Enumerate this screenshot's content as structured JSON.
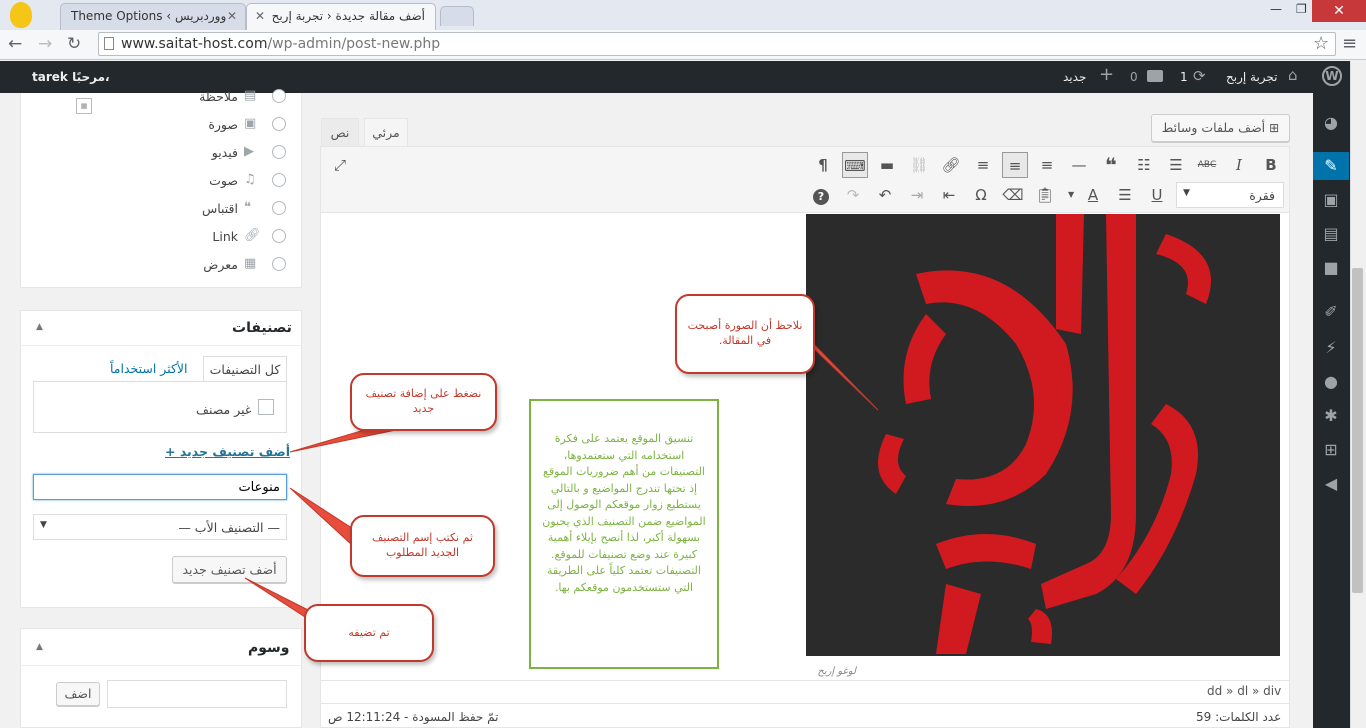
{
  "browser": {
    "tabs": [
      {
        "title": "Theme Options ‹ ووردبريس"
      },
      {
        "title": "أضف مقالة جديدة ‹ تجربة إربح"
      }
    ],
    "url_host": "www.saitat-host.com",
    "url_path": "/wp-admin/post-new.php"
  },
  "adminbar": {
    "site_name": "تجربة إربح",
    "updates": "1",
    "comments": "0",
    "new_label": "جديد",
    "greeting_user": "tarek",
    "greeting_prefix": "مرحبًا،"
  },
  "formats": {
    "items": [
      {
        "label": "ملاحظة",
        "icon": "note-icon"
      },
      {
        "label": "صورة",
        "icon": "image-icon"
      },
      {
        "label": "فيديو",
        "icon": "video-icon"
      },
      {
        "label": "صوت",
        "icon": "audio-icon"
      },
      {
        "label": "اقتباس",
        "icon": "quote-icon"
      },
      {
        "label": "Link",
        "icon": "link-icon"
      },
      {
        "label": "معرض",
        "icon": "gallery-icon"
      }
    ]
  },
  "categories": {
    "title": "تصنيفات",
    "tab_all": "كل التصنيفات",
    "tab_popular": "الأكثر استخداماً",
    "uncategorized": "غير مصنف",
    "add_link": "+ أضف تصنيف جديد",
    "new_value": "منوعات",
    "parent_select": "— التصنيف الأب —",
    "add_button": "أضف تصنيف جديد"
  },
  "tags": {
    "title": "وسوم",
    "add_button": "اضف"
  },
  "editor": {
    "add_media": "أضف ملفات وسائط",
    "tab_visual": "مرئي",
    "tab_text": "نص",
    "paragraph_select": "فقرة",
    "image_caption": "لوغو إربح",
    "path": "dd » dl » div",
    "word_count_label": "عدد الكلمات:",
    "word_count": "59",
    "draft_saved": "تمّ حفظ المسودة - 12:11:24 ص"
  },
  "callouts": {
    "image_note": "نلاحظ أن الصورة أصبحت في المقالة.",
    "click_add": "نضغط على إضافة تصنيف جديد",
    "write_name": "ثم نكتب إسم التصنيف الجديد المطلوب",
    "added": "تم تضيفه",
    "info": "تنسيق الموقع يعتمد على فكرة استخدامه التي ستعتمدوها، التصنيفات من أهم ضروريات الموقع إذ تحتها تندرج المواضيع و بالتالي يستطيع زوار موقعكم الوصول إلى المواضيع ضمن التصنيف الذي يحبون بسهولة أكبر، لذا أنصح بإيلاء أهمية كبيرة عند وضع تصنيفات للموقع. التصنيفات تعتمد كلياً على الطريقة التي ستستخدمون موقعكم بها."
  },
  "colors": {
    "accent": "#0073aa",
    "callout_red": "#c0392b",
    "info_green": "#7cb342",
    "logo_red": "#d01a1f"
  }
}
